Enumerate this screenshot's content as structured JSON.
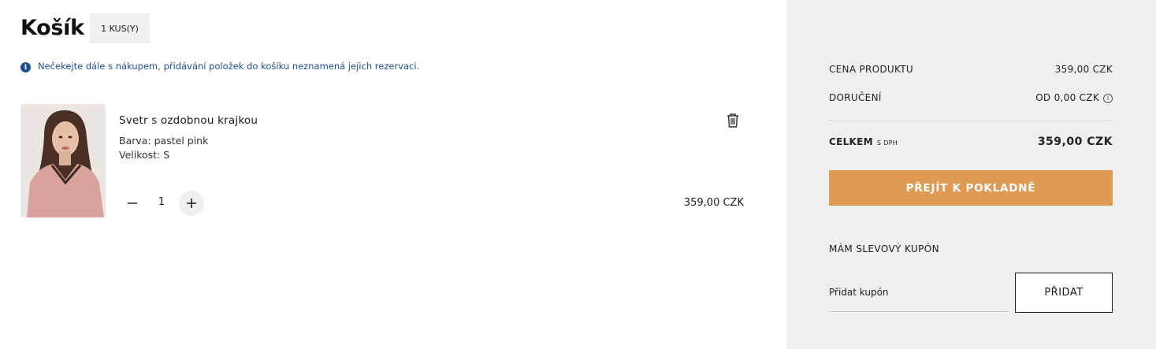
{
  "cart": {
    "title": "Košík",
    "count_badge": "1 KUS(Y)",
    "notice": "Nečekejte dále s nákupem, přidávání položek do košíku neznamená jejich rezervaci."
  },
  "items": [
    {
      "name": "Svetr s ozdobnou krajkou",
      "color": "Barva: pastel pink",
      "size": "Velikost: S",
      "quantity": "1",
      "price": "359,00 CZK"
    }
  ],
  "summary": {
    "product_label": "CENA PRODUKTU",
    "product_value": "359,00 CZK",
    "delivery_label": "DORUČENÍ",
    "delivery_value": "OD 0,00 CZK",
    "total_label": "CELKEM",
    "total_vat_note": "S DPH",
    "total_value": "359,00 CZK",
    "checkout_label": "PŘEJÍT K POKLADNĚ"
  },
  "coupon": {
    "title": "MÁM SLEVOVÝ KUPÓN",
    "placeholder": "Přidat kupón",
    "button_label": "PŘIDAT"
  },
  "colors": {
    "accent": "#e09a53",
    "notice_blue": "#1d4f91",
    "sidebar_bg": "#efefef"
  },
  "icons": {
    "notice": "info-icon",
    "remove": "trash-icon",
    "decrease": "minus-icon",
    "increase": "plus-icon",
    "delivery_info": "info-circle-icon"
  }
}
